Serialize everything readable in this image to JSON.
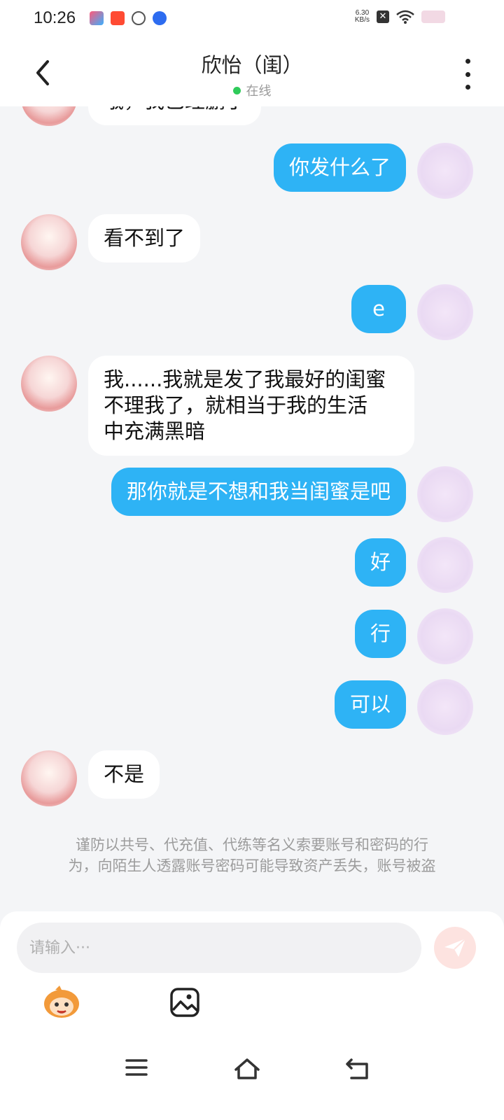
{
  "status_bar": {
    "time": "10:26",
    "net_speed_value": "6.30",
    "net_speed_unit": "KB/s"
  },
  "header": {
    "title": "欣怡（闺）",
    "presence": "在线"
  },
  "messages": [
    {
      "side": "in",
      "text": "哦，我已经删了"
    },
    {
      "side": "out",
      "text": "你发什么了"
    },
    {
      "side": "in",
      "text": "看不到了"
    },
    {
      "side": "out",
      "text": "e"
    },
    {
      "side": "in",
      "line1": "我......我就是发了我最好的闺蜜",
      "line2": "不理我了，就相当于我的生活",
      "line3": "中充满黑暗"
    },
    {
      "side": "out",
      "text": "那你就是不想和我当闺蜜是吧"
    },
    {
      "side": "out",
      "text": "好"
    },
    {
      "side": "out",
      "text": "行"
    },
    {
      "side": "out",
      "text": "可以"
    },
    {
      "side": "in",
      "text": "不是"
    }
  ],
  "notice": {
    "line1": "谨防以共号、代充值、代练等名义索要账号和密码的行",
    "line2": "为，向陌生人透露账号密码可能导致资产丢失，账号被盗"
  },
  "composer": {
    "placeholder": "请输入···"
  },
  "colors": {
    "outgoing_bubble": "#2eb3f5",
    "incoming_bubble": "#ffffff",
    "online_dot": "#2fcb5a",
    "background": "#f4f5f7"
  },
  "icons": [
    "back-icon",
    "more-icon",
    "send-icon",
    "emoji-mascot-icon",
    "image-icon",
    "menu-icon",
    "home-icon",
    "back-nav-icon"
  ]
}
